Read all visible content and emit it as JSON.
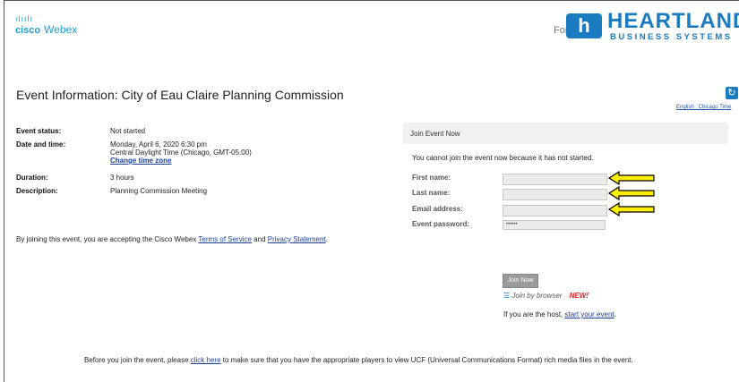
{
  "header": {
    "cisco_bars": "ılıılı",
    "cisco_word": "cisco",
    "product": "Webex",
    "for_text": "For",
    "partner_logo_letter": "h",
    "partner_name": "HEARTLAND",
    "partner_sub": "BUSINESS SYSTEMS"
  },
  "page": {
    "title": "Event Information: City of Eau Claire Planning Commission",
    "refresh_icon": "↻",
    "lang_link": "English : Chicago Time"
  },
  "event": {
    "status_label": "Event status:",
    "status_value": "Not started",
    "datetime_label": "Date and time:",
    "datetime_value": "Monday, April 6, 2020 6:30 pm",
    "timezone_value": "Central Daylight Time (Chicago, GMT-05:00)",
    "change_tz": "Change time zone",
    "duration_label": "Duration:",
    "duration_value": "3 hours",
    "description_label": "Description:",
    "description_value": "Planning Commission Meeting"
  },
  "terms": {
    "prefix": "By joining this event, you are accepting the Cisco Webex ",
    "tos_link": "Terms of Service",
    "and": " and ",
    "privacy_link": "Privacy Statement",
    "suffix": "."
  },
  "join": {
    "header": "Join Event Now",
    "notice": "You cannot join the event now because it has not started.",
    "first_name_label": "First name:",
    "last_name_label": "Last name:",
    "email_label": "Email address:",
    "password_label": "Event password:",
    "first_name_value": "",
    "last_name_value": "",
    "email_value": "",
    "password_value": "••••••",
    "join_button": "Join Now",
    "browser_icon": "☰",
    "browser_link": "Join by browser",
    "new_badge": "NEW!",
    "host_prefix": "If you are the host, ",
    "host_link": "start your event",
    "host_suffix": "."
  },
  "footer": {
    "prefix": "Before you join the event, please ",
    "click_here": "click here",
    "suffix": " to make sure that you have the appropriate players to view UCF (Universal Communications Format) rich media files in the event."
  },
  "colors": {
    "cisco_blue": "#1ba0d7",
    "heartland_blue": "#1b7bc0",
    "arrow_yellow": "#ffee00",
    "new_red": "#e02020"
  }
}
